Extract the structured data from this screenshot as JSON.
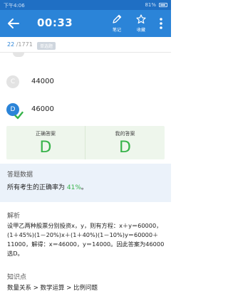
{
  "status_bar": {
    "time": "下午4:06",
    "battery": "81%"
  },
  "app_bar": {
    "timer": "00:33",
    "note_label": "笔记",
    "favorite_label": "收藏"
  },
  "progress": {
    "current": "22",
    "total": "/1771",
    "tag": "单选题"
  },
  "options": [
    {
      "letter": "C",
      "value": "44000",
      "selected": false
    },
    {
      "letter": "D",
      "value": "46000",
      "selected": true
    }
  ],
  "answer_compare": {
    "correct_label": "正确答案",
    "correct_value": "D",
    "mine_label": "我的答案",
    "mine_value": "D"
  },
  "stats": {
    "heading": "答题数据",
    "text_prefix": "所有考生的正确率为",
    "percent": "41%",
    "text_suffix": "。"
  },
  "analysis": {
    "heading": "解析",
    "body": "设甲乙两种股票分别投资x，y，则有方程：x＋y＝60000，(1＋45%)(1－20%)x＋(1＋40%)(1－10%)y＝60000＋11000，解得：x＝46000，y＝14000。因此答案为46000选D。"
  },
  "knowledge": {
    "heading": "知识点",
    "path": "数量关系 > 数学运算 > 比例问题"
  },
  "colors": {
    "primary": "#2b84d8",
    "status_bar": "#1f6fc4",
    "correct_green": "#37b34a",
    "answer_bg": "#eef6ec",
    "stats_bg": "#ebf2fa"
  }
}
